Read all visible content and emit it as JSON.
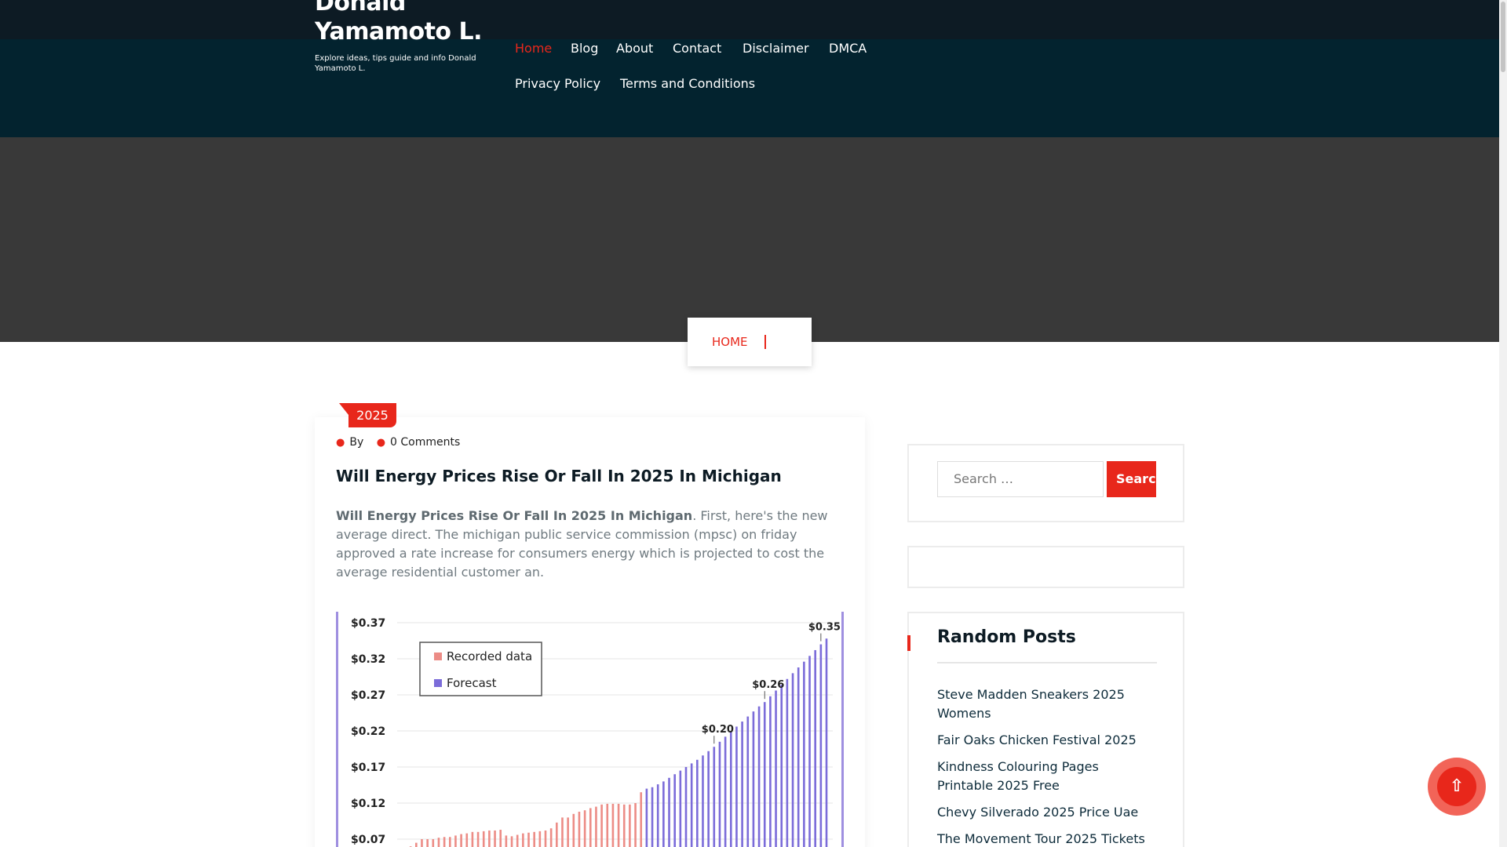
{
  "site": {
    "title": "Donald Yamamoto L.",
    "tagline": "Explore ideas, tips guide and info Donald Yamamoto L."
  },
  "nav": {
    "items": [
      {
        "label": "Home",
        "active": true
      },
      {
        "label": "Blog"
      },
      {
        "label": "About"
      },
      {
        "label": "Contact"
      },
      {
        "label": "Disclaimer"
      },
      {
        "label": "DMCA"
      },
      {
        "label": "Privacy Policy"
      },
      {
        "label": "Terms and Conditions"
      }
    ]
  },
  "breadcrumb": {
    "home": "HOME"
  },
  "post": {
    "category": "2025",
    "by_label": "By",
    "comments_label": "0 Comments",
    "title": "Will Energy Prices Rise Or Fall In 2025 In Michigan",
    "excerpt_bold": "Will Energy Prices Rise Or Fall In 2025 In Michigan",
    "excerpt_rest": ". First, here's the new average direct. The michigan public service commission (mpsc) on friday approved a rate increase for consumers energy which is projected to cost the average residential customer an."
  },
  "sidebar": {
    "search": {
      "placeholder": "Search …",
      "button": "Search"
    },
    "random_posts": {
      "title": "Random Posts",
      "items": [
        "Steve Madden Sneakers 2025 Womens",
        "Fair Oaks Chicken Festival 2025",
        "Kindness Colouring Pages Printable 2025 Free",
        "Chevy Silverado 2025 Price Uae",
        "The Movement Tour 2025 Tickets"
      ]
    }
  },
  "back_to_top_icon": "arrow-up-icon",
  "colors": {
    "accent": "#e8271b",
    "header": "#03232f",
    "recorded": "#ec8c86",
    "forecast": "#7b6cd9"
  },
  "chart_data": {
    "type": "bar",
    "title": "",
    "xlabel": "",
    "ylabel": "",
    "yticks": [
      "$0.37",
      "$0.32",
      "$0.27",
      "$0.22",
      "$0.17",
      "$0.12",
      "$0.07"
    ],
    "ylim": [
      0.05,
      0.38
    ],
    "legend": [
      "Recorded data",
      "Forecast"
    ],
    "legend_position": "top-left",
    "annotations": [
      "$0.20",
      "$0.26",
      "$0.35"
    ],
    "series": [
      {
        "name": "Recorded data",
        "values": [
          0.055,
          0.06,
          0.065,
          0.07,
          0.07,
          0.07,
          0.072,
          0.073,
          0.073,
          0.075,
          0.077,
          0.078,
          0.08,
          0.08,
          0.081,
          0.082,
          0.082,
          0.083,
          0.075,
          0.074,
          0.076,
          0.078,
          0.079,
          0.08,
          0.081,
          0.082,
          0.085,
          0.093,
          0.1,
          0.1,
          0.105,
          0.108,
          0.11,
          0.113,
          0.115,
          0.118,
          0.119,
          0.119,
          0.119,
          0.118,
          0.118,
          0.12,
          0.135
        ]
      },
      {
        "name": "Forecast",
        "values": [
          0.14,
          0.142,
          0.146,
          0.15,
          0.155,
          0.16,
          0.165,
          0.17,
          0.175,
          0.18,
          0.186,
          0.192,
          0.198,
          0.205,
          0.212,
          0.22,
          0.226,
          0.233,
          0.24,
          0.247,
          0.254,
          0.26,
          0.268,
          0.276,
          0.284,
          0.292,
          0.3,
          0.308,
          0.316,
          0.324,
          0.332,
          0.34,
          0.348
        ]
      }
    ]
  }
}
